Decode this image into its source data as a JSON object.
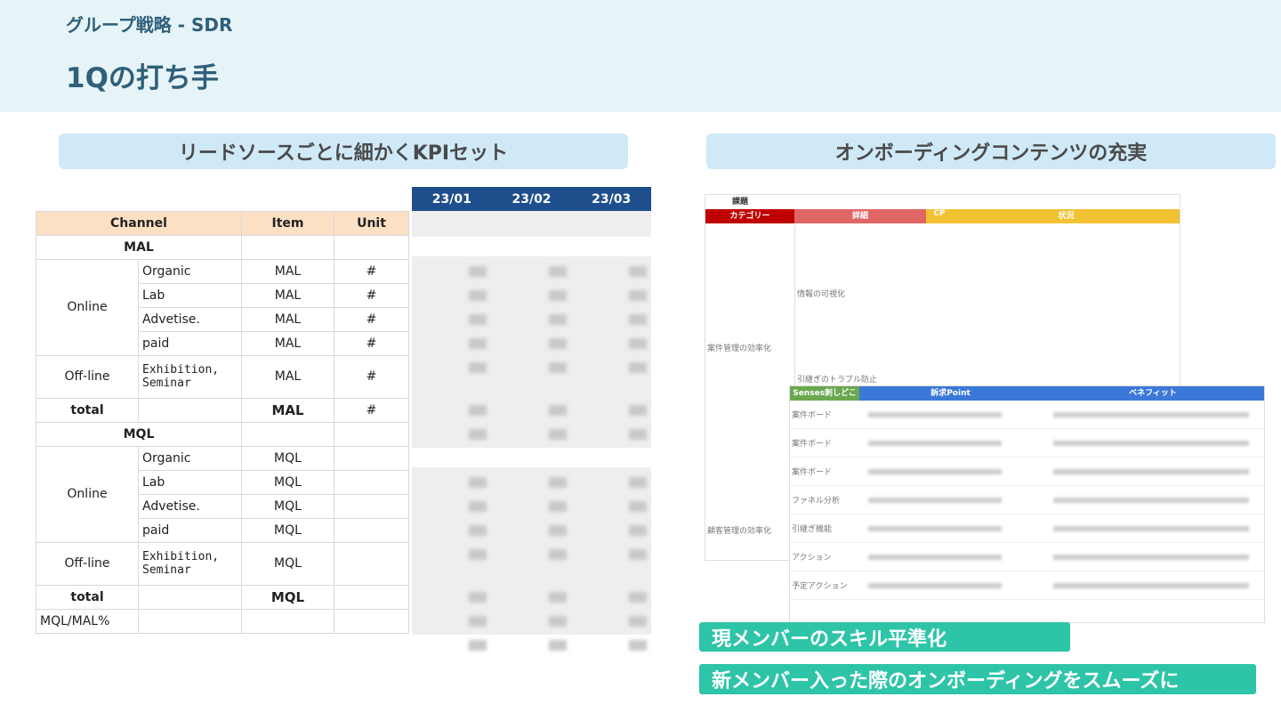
{
  "header": {
    "subtitle": "グループ戦略 - SDR",
    "title": "1Qの打ち手"
  },
  "left": {
    "heading": "リードソースごとに細かくKPIセット",
    "columns": [
      "Channel",
      "Item",
      "Unit"
    ],
    "months": [
      "23/01",
      "23/02",
      "23/03"
    ],
    "mal_section": "MAL",
    "mql_section": "MQL",
    "online": "Online",
    "offline": "Off-line",
    "total": "total",
    "ratio": "MQL/MAL%",
    "sources": [
      "Organic",
      "Lab",
      "Advetise.",
      "paid"
    ],
    "exhibition": "Exhibition,\nSeminar",
    "unit_hash": "#",
    "item_mal": "MAL",
    "item_mql": "MQL"
  },
  "right": {
    "heading": "オンボーディングコンテンツの充実",
    "sheet1": {
      "title": "課題",
      "headers": [
        "カテゴリー",
        "詳細",
        "CP",
        "状況"
      ],
      "category": "案件管理の効率化",
      "category2": "顧客管理の効率化",
      "details": [
        "情報の可視化",
        "引継ぎのトラブル防止"
      ]
    },
    "sheet2": {
      "headers": [
        "Senses刺しどころ",
        "訴求Point",
        "ベネフィット"
      ],
      "rows": [
        "案件ボード",
        "案件ボード",
        "案件ボード",
        "ファネル分析",
        "引継ぎ機能",
        "アクション",
        "予定アクション"
      ]
    },
    "points": [
      "現メンバーのスキル平準化",
      "新メンバー入った際のオンボーディングをスムーズに"
    ]
  },
  "colors": {
    "header_bg": "#e6f4f7",
    "accent": "#2f5f7a",
    "teal": "#2ec4a8",
    "month_header": "#1f4e8c",
    "channel_header": "#fce0c4"
  }
}
